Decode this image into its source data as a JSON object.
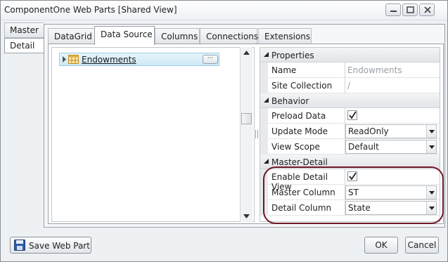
{
  "window": {
    "title": "ComponentOne Web Parts [Shared View]"
  },
  "left_tabs": [
    {
      "label": "Master"
    },
    {
      "label": "Detail"
    }
  ],
  "tabs": [
    {
      "label": "DataGrid"
    },
    {
      "label": "Data Source"
    },
    {
      "label": "Columns"
    },
    {
      "label": "Connections"
    },
    {
      "label": "Extensions"
    }
  ],
  "active_tab": "Data Source",
  "tree": {
    "item_label": "Endowments",
    "more_label": "···"
  },
  "properties": {
    "groups": {
      "properties": "Properties",
      "behavior": "Behavior",
      "master_detail": "Master-Detail"
    },
    "name": {
      "label": "Name",
      "value": "Endowments"
    },
    "site_collection": {
      "label": "Site Collection",
      "value": "/"
    },
    "preload_data": {
      "label": "Preload Data",
      "checked": true
    },
    "update_mode": {
      "label": "Update Mode",
      "value": "ReadOnly"
    },
    "view_scope": {
      "label": "View Scope",
      "value": "Default"
    },
    "enable_detail_view": {
      "label": "Enable Detail View",
      "checked": true
    },
    "master_column": {
      "label": "Master Column",
      "value": "ST"
    },
    "detail_column": {
      "label": "Detail Column",
      "value": "State"
    }
  },
  "buttons": {
    "save": "Save Web Part",
    "ok": "OK",
    "cancel": "Cancel"
  },
  "colors": {
    "highlight_ring": "#6f1626",
    "tree_selection": "#cfe9f6"
  }
}
